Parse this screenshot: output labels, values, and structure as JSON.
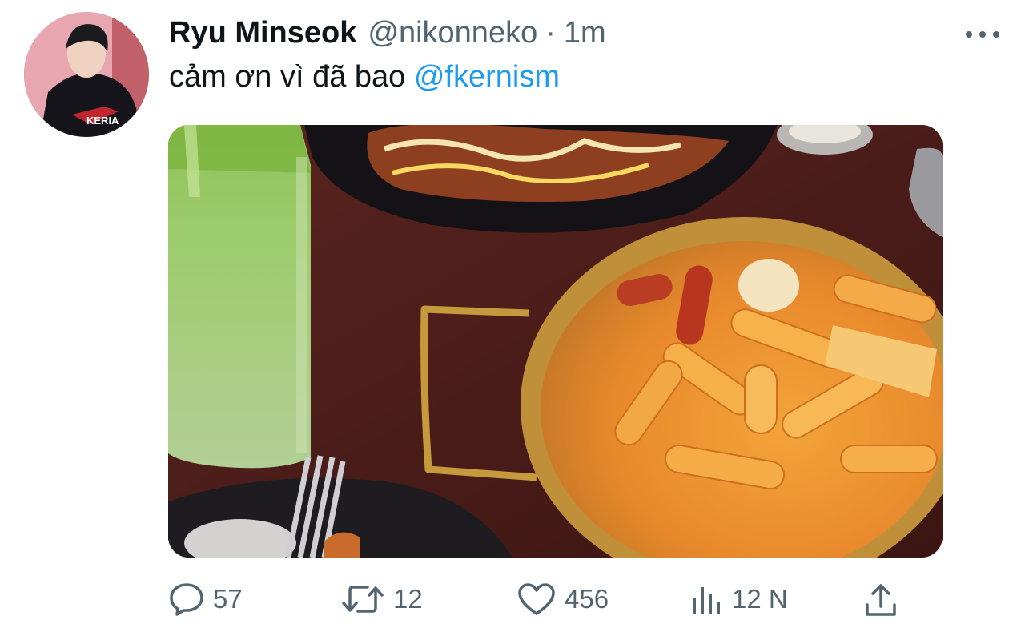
{
  "tweet": {
    "author_name": "Ryu Minseok",
    "handle": "@nikonneko",
    "separator": "·",
    "time": "1m",
    "text_prefix": "cảm ơn vì đã bao ",
    "mention": "@fkernism",
    "avatar_jersey_text": "KERIA"
  },
  "actions": {
    "replies": "57",
    "retweets": "12",
    "likes": "456",
    "views": "12 N"
  },
  "icons": {
    "more": "more-dots-icon",
    "reply": "reply-bubble-icon",
    "retweet": "retweet-icon",
    "like": "heart-icon",
    "views": "views-bar-chart-icon",
    "share": "share-upload-icon"
  },
  "colors": {
    "mention": "#1d9bf0",
    "secondary_text": "#536471",
    "primary_text": "#0f1419"
  }
}
